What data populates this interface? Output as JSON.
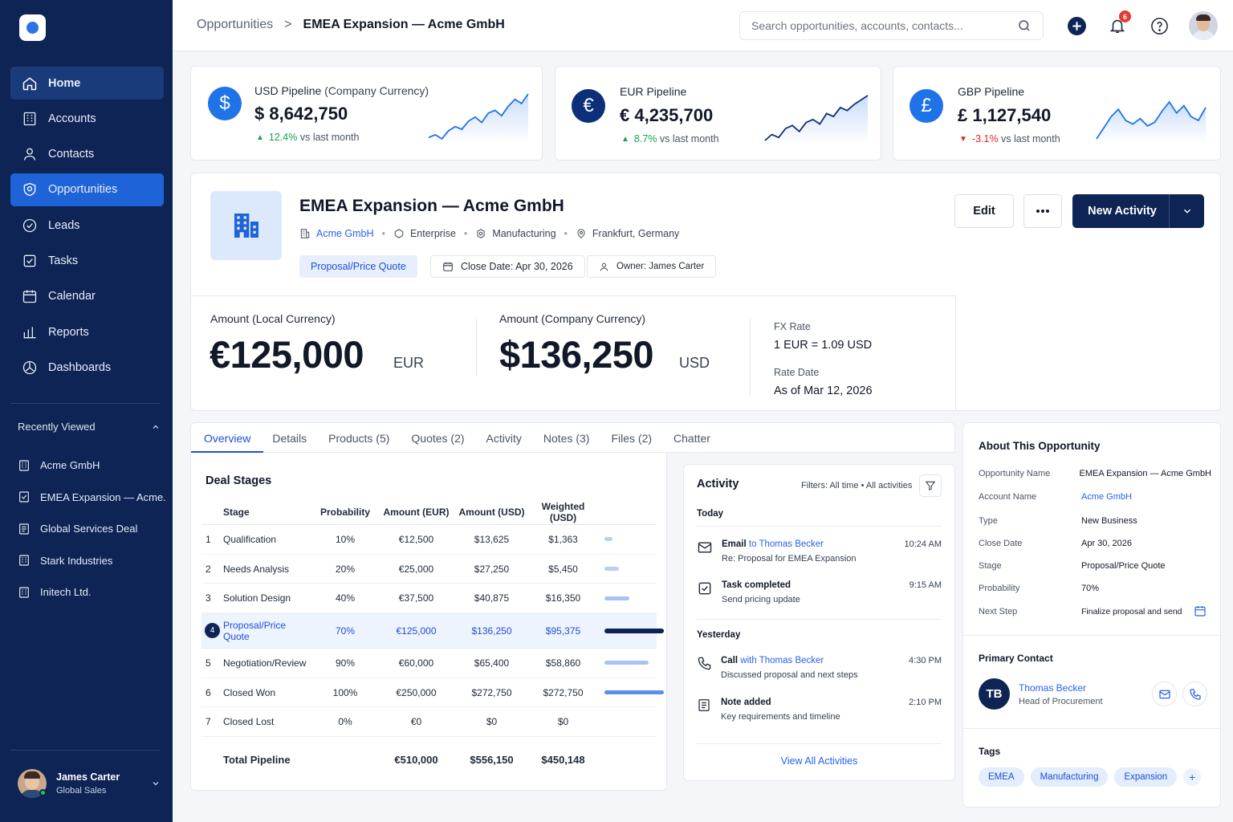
{
  "sidebar": {
    "nav": [
      {
        "label": "Home",
        "icon": "home-icon"
      },
      {
        "label": "Accounts",
        "icon": "building-icon"
      },
      {
        "label": "Contacts",
        "icon": "user-icon"
      },
      {
        "label": "Opportunities",
        "icon": "target-icon"
      },
      {
        "label": "Leads",
        "icon": "gauge-icon"
      },
      {
        "label": "Tasks",
        "icon": "checkbox-icon"
      },
      {
        "label": "Calendar",
        "icon": "calendar-icon"
      },
      {
        "label": "Reports",
        "icon": "bar-chart-icon"
      },
      {
        "label": "Dashboards",
        "icon": "dashboard-icon"
      }
    ],
    "recent_title": "Recently Viewed",
    "recent": [
      "Acme GmbH",
      "EMEA Expansion — Acme...",
      "Global Services Deal",
      "Stark Industries",
      "Initech Ltd."
    ],
    "user": {
      "name": "James Carter",
      "role": "Global Sales"
    }
  },
  "header": {
    "breadcrumb_parent": "Opportunities",
    "breadcrumb_sep": ">",
    "breadcrumb_current": "EMEA Expansion — Acme GmbH",
    "search_placeholder": "Search opportunities, accounts, contacts...",
    "notification_count": "6"
  },
  "pipelines": [
    {
      "symbol": "$",
      "label": "USD Pipeline",
      "sub": "(Company Currency)",
      "value": "$ 8,642,750",
      "delta": "12.4%",
      "direction": "up",
      "delta_suffix": "vs last month",
      "color": "#1f73e8",
      "spark": [
        10,
        12,
        9,
        15,
        18,
        16,
        22,
        25,
        21,
        28,
        30,
        26,
        33,
        38,
        35,
        42
      ]
    },
    {
      "symbol": "€",
      "label": "EUR Pipeline",
      "sub": "",
      "value": "€ 4,235,700",
      "delta": "8.7%",
      "direction": "up",
      "delta_suffix": "vs last month",
      "color": "#0d2f7a",
      "spark": [
        8,
        12,
        10,
        16,
        18,
        14,
        20,
        22,
        19,
        26,
        24,
        30,
        28,
        32,
        35,
        38
      ]
    },
    {
      "symbol": "£",
      "label": "GBP Pipeline",
      "sub": "",
      "value": "£ 1,127,540",
      "delta": "-3.1%",
      "direction": "down",
      "delta_suffix": "vs last month",
      "color": "#1f73e8",
      "spark": [
        10,
        16,
        22,
        26,
        20,
        18,
        21,
        17,
        19,
        25,
        30,
        24,
        28,
        22,
        20,
        27
      ]
    }
  ],
  "opportunity": {
    "title": "EMEA Expansion — Acme GmbH",
    "account": "Acme GmbH",
    "segment": "Enterprise",
    "industry": "Manufacturing",
    "location": "Frankfurt, Germany",
    "stage": "Proposal/Price Quote",
    "close_date": "Close Date: Apr 30, 2026",
    "owner": "Owner: James Carter",
    "edit_label": "Edit",
    "new_activity_label": "New Activity",
    "local_label": "Amount (Local Currency)",
    "local_value": "€125,000",
    "local_currency": "EUR",
    "company_label": "Amount (Company Currency)",
    "company_value": "$136,250",
    "company_currency": "USD",
    "fx_label": "FX Rate",
    "fx_value": "1 EUR = 1.09 USD",
    "rate_date_label": "Rate Date",
    "rate_date_value": "As of Mar 12, 2026"
  },
  "tabs": [
    "Overview",
    "Details",
    "Products (5)",
    "Quotes (2)",
    "Activity",
    "Notes (3)",
    "Files (2)",
    "Chatter"
  ],
  "deal_stages": {
    "title": "Deal Stages",
    "columns": [
      "Stage",
      "Probability",
      "Amount (EUR)",
      "Amount (USD)",
      "Weighted (USD)"
    ],
    "rows": [
      {
        "n": "1",
        "stage": "Qualification",
        "prob": "10%",
        "eur": "€12,500",
        "usd": "$13,625",
        "weighted": "$1,363",
        "progress": 0.14
      },
      {
        "n": "2",
        "stage": "Needs Analysis",
        "prob": "20%",
        "eur": "€25,000",
        "usd": "$27,250",
        "weighted": "$5,450",
        "progress": 0.24
      },
      {
        "n": "3",
        "stage": "Solution Design",
        "prob": "40%",
        "eur": "€37,500",
        "usd": "$40,875",
        "weighted": "$16,350",
        "progress": 0.42
      },
      {
        "n": "4",
        "stage": "Proposal/Price Quote",
        "prob": "70%",
        "eur": "€125,000",
        "usd": "$136,250",
        "weighted": "$95,375",
        "progress": 1.0,
        "current": true
      },
      {
        "n": "5",
        "stage": "Negotiation/Review",
        "prob": "90%",
        "eur": "€60,000",
        "usd": "$65,400",
        "weighted": "$58,860",
        "progress": 0.74
      },
      {
        "n": "6",
        "stage": "Closed Won",
        "prob": "100%",
        "eur": "€250,000",
        "usd": "$272,750",
        "weighted": "$272,750",
        "progress": 1.0
      },
      {
        "n": "7",
        "stage": "Closed Lost",
        "prob": "0%",
        "eur": "€0",
        "usd": "$0",
        "weighted": "$0",
        "progress": 0
      }
    ],
    "total": {
      "label": "Total Pipeline",
      "eur": "€510,000",
      "usd": "$556,150",
      "weighted": "$450,148"
    }
  },
  "activity": {
    "title": "Activity",
    "filters": "Filters: All time • All activities",
    "today": "Today",
    "yesterday": "Yesterday",
    "items": [
      {
        "type": "Email",
        "link": "to Thomas Becker",
        "desc": "Re: Proposal for EMEA Expansion",
        "time": "10:24 AM",
        "icon": "mail-icon"
      },
      {
        "type": "Task completed",
        "link": "",
        "desc": "Send pricing update",
        "time": "9:15 AM",
        "icon": "checkbox-icon"
      },
      {
        "type": "Call",
        "link": "with Thomas Becker",
        "desc": "Discussed proposal and next steps",
        "time": "4:30 PM",
        "icon": "phone-icon"
      },
      {
        "type": "Note added",
        "link": "",
        "desc": "Key requirements and timeline",
        "time": "2:10 PM",
        "icon": "note-icon"
      }
    ],
    "view_all": "View All Activities"
  },
  "about": {
    "title": "About This Opportunity",
    "fields": [
      {
        "k": "Opportunity Name",
        "v": "EMEA Expansion — Acme GmbH"
      },
      {
        "k": "Account Name",
        "v": "Acme GmbH",
        "link": true
      },
      {
        "k": "Type",
        "v": "New Business"
      },
      {
        "k": "Close Date",
        "v": "Apr 30, 2026"
      },
      {
        "k": "Stage",
        "v": "Proposal/Price Quote"
      },
      {
        "k": "Probability",
        "v": "70%"
      },
      {
        "k": "Next Step",
        "v": "Finalize proposal and send"
      }
    ],
    "contact_title": "Primary Contact",
    "contact_initials": "TB",
    "contact_name": "Thomas Becker",
    "contact_role": "Head of Procurement",
    "tags_title": "Tags",
    "tags": [
      "EMEA",
      "Manufacturing",
      "Expansion"
    ]
  }
}
